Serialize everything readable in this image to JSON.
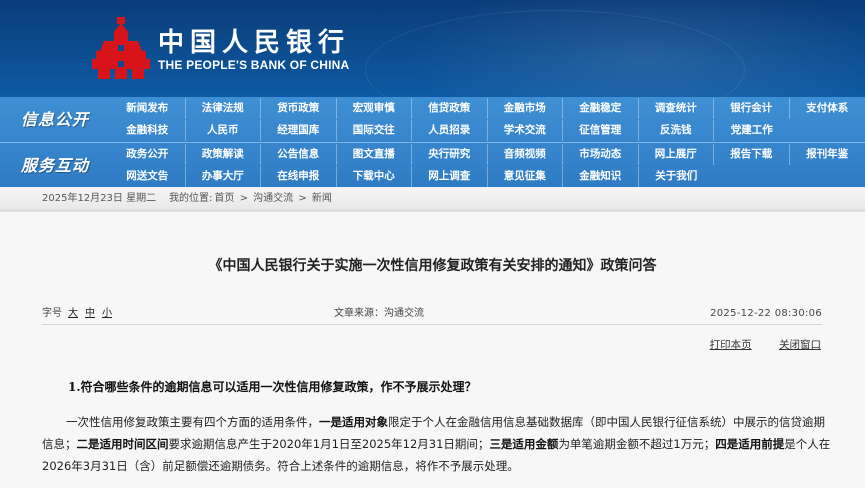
{
  "header": {
    "logo_cn": "中国人民银行",
    "logo_en": "THE PEOPLE'S BANK OF CHINA"
  },
  "nav": {
    "section1_title": "信息公开",
    "section1_row1": [
      "新闻发布",
      "法律法规",
      "货币政策",
      "宏观审慎",
      "信贷政策",
      "金融市场",
      "金融稳定",
      "调查统计",
      "银行会计",
      "支付体系"
    ],
    "section1_row2": [
      "金融科技",
      "人民币",
      "经理国库",
      "国际交往",
      "人员招录",
      "学术交流",
      "征信管理",
      "反洗钱",
      "党建工作"
    ],
    "section2_title": "服务互动",
    "section2_row1": [
      "政务公开",
      "政策解读",
      "公告信息",
      "图文直播",
      "央行研究",
      "音频视频",
      "市场动态",
      "网上展厅",
      "报告下载",
      "报刊年鉴"
    ],
    "section2_row2": [
      "网送文告",
      "办事大厅",
      "在线申报",
      "下载中心",
      "网上调查",
      "意见征集",
      "金融知识",
      "关于我们"
    ]
  },
  "breadcrumb": {
    "date": "2025年12月23日  星期二",
    "prefix": "我的位置:",
    "items": [
      "首页",
      "沟通交流",
      "新闻"
    ],
    "sep": ">"
  },
  "article": {
    "title": "《中国人民银行关于实施一次性信用修复政策有关安排的通知》政策问答",
    "font_label": "字号",
    "font_large": "大",
    "font_medium": "中",
    "font_small": "小",
    "source": "文章来源：沟通交流",
    "time": "2025-12-22  08:30:06",
    "print": "打印本页",
    "close": "关闭窗口",
    "q1": "1.符合哪些条件的逾期信息可以适用一次性信用修复政策，作不予展示处理？",
    "p1_a": "一次性信用修复政策主要有四个方面的适用条件，",
    "p1_b": "一是适用对象",
    "p1_c": "限定于个人在金融信用信息基础数据库（即中国人民银行征信系统）中展示的信贷逾期信息；",
    "p1_d": "二是适用时间区间",
    "p1_e": "要求逾期信息产生于2020年1月1日至2025年12月31日期间；",
    "p1_f": "三是适用金额",
    "p1_g": "为单笔逾期金额不超过1万元；",
    "p1_h": "四是适用前提",
    "p1_i": "是个人在2026年3月31日（含）前足额偿还逾期债务。符合上述条件的逾期信息，将作不予展示处理。"
  }
}
